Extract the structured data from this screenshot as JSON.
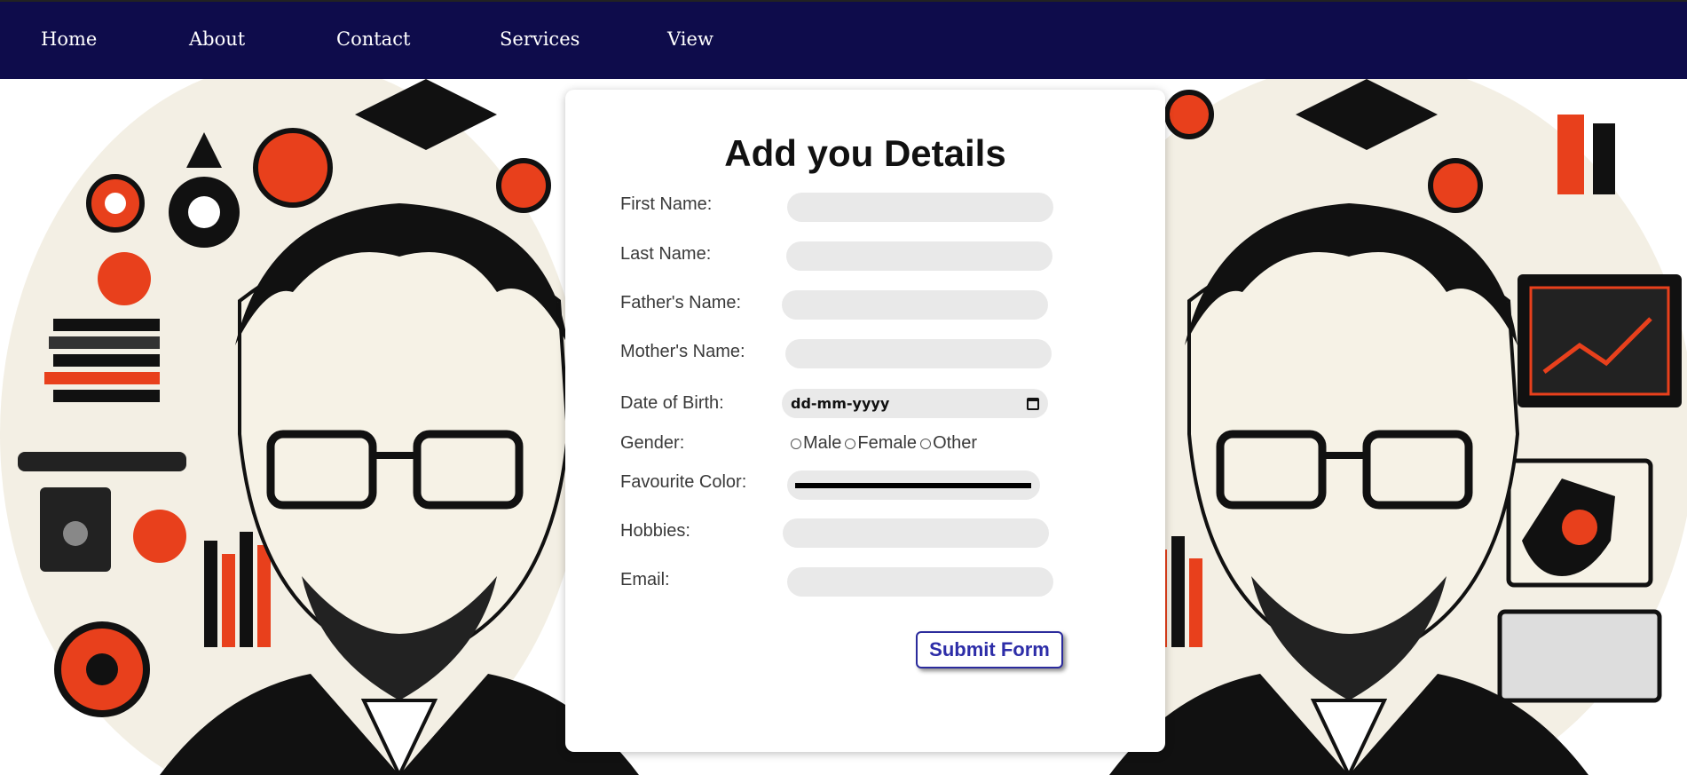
{
  "nav": {
    "items": [
      {
        "label": "Home"
      },
      {
        "label": "About"
      },
      {
        "label": "Contact"
      },
      {
        "label": "Services"
      },
      {
        "label": "View"
      }
    ]
  },
  "form": {
    "title": "Add you Details",
    "fields": {
      "first_name": {
        "label": "First Name:",
        "value": ""
      },
      "last_name": {
        "label": "Last Name:",
        "value": ""
      },
      "father_name": {
        "label": "Father's Name:",
        "value": ""
      },
      "mother_name": {
        "label": "Mother's Name:",
        "value": ""
      },
      "dob": {
        "label": "Date of Birth:",
        "value": "dd-mm-yyyy"
      },
      "gender": {
        "label": "Gender:",
        "options": [
          "Male",
          "Female",
          "Other"
        ]
      },
      "favourite_color": {
        "label": "Favourite Color:",
        "value": "#000000"
      },
      "hobbies": {
        "label": "Hobbies:",
        "value": ""
      },
      "email": {
        "label": "Email:",
        "value": ""
      }
    },
    "submit_label": "Submit Form"
  },
  "colors": {
    "nav_bg": "#0e0c4b",
    "accent_orange": "#e8401c",
    "button_text": "#2d2da8"
  },
  "background": {
    "icon": "student-illustration-art"
  }
}
